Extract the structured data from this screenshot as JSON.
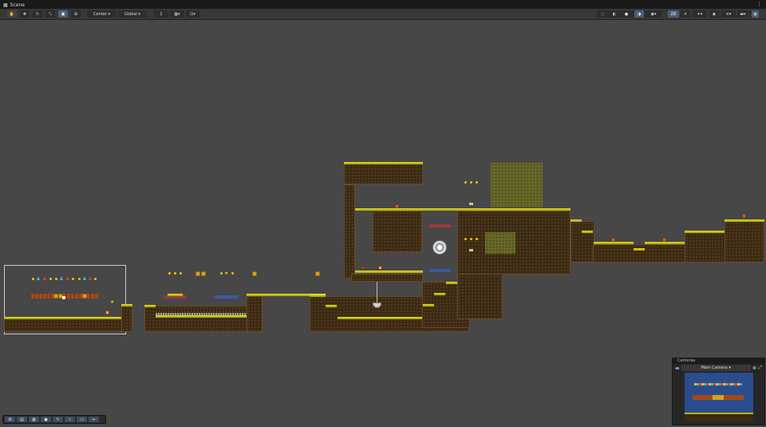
{
  "window": {
    "tab_title": "Scene"
  },
  "toolbar": {
    "pivot": "Center",
    "space": "Global",
    "grid_size": "1",
    "mode_2d": "2D"
  },
  "cameras": {
    "title": "Cameras",
    "selected": "Main Camera"
  },
  "colors": {
    "grass": "#b8b400",
    "dirt": "#3b2a14",
    "coin": "#f2c200",
    "sky_preview": "#2b4d8e",
    "platform_red": "#9e3a3a",
    "platform_blue": "#3a5a9e"
  },
  "icons": [
    "hand-tool-icon",
    "move-tool-icon",
    "rotate-tool-icon",
    "scale-tool-icon",
    "rect-tool-icon",
    "transform-tool-icon",
    "grid-icon",
    "snap-icon",
    "gizmos-icon",
    "camera-icon",
    "eye-icon",
    "search-icon"
  ]
}
